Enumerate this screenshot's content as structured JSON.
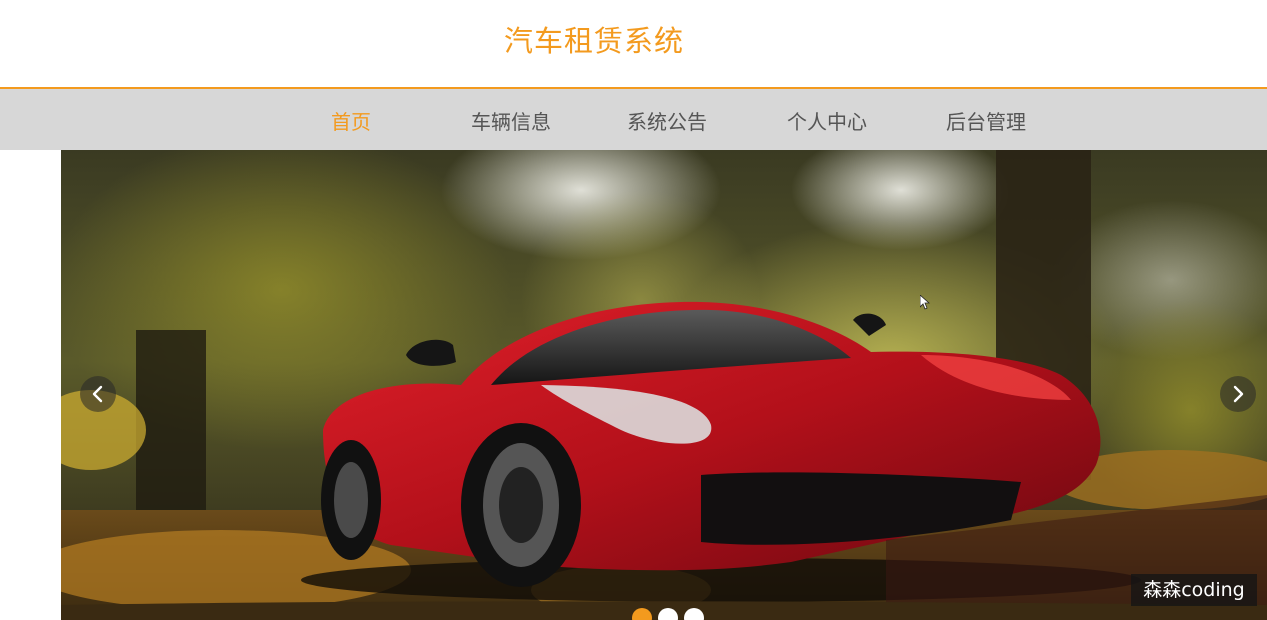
{
  "header": {
    "title": "汽车租赁系统"
  },
  "nav": {
    "items": [
      {
        "label": "首页",
        "active": true
      },
      {
        "label": "车辆信息",
        "active": false
      },
      {
        "label": "系统公告",
        "active": false
      },
      {
        "label": "个人中心",
        "active": false
      },
      {
        "label": "后台管理",
        "active": false
      }
    ]
  },
  "carousel": {
    "slide_image": "red-sports-car-autumn-forest",
    "prev_icon": "chevron-left-icon",
    "next_icon": "chevron-right-icon",
    "slide_count": 3,
    "active_slide": 1
  },
  "watermark": {
    "text": "森森coding"
  },
  "colors": {
    "accent": "#f39a1e",
    "nav_bg": "#d7d7d7",
    "nav_text": "#555555"
  }
}
